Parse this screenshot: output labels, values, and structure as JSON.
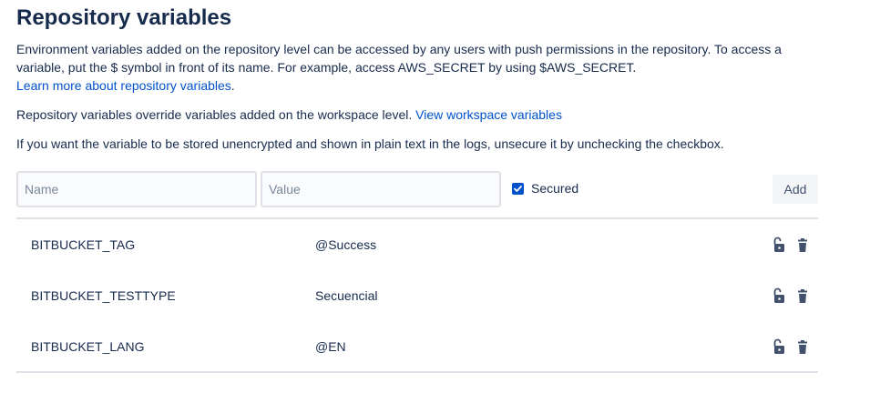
{
  "header": {
    "title": "Repository variables"
  },
  "intro": {
    "text": "Environment variables added on the repository level can be accessed by any users with push permissions in the repository. To access a variable, put the $ symbol in front of its name. For example, access AWS_SECRET by using $AWS_SECRET.",
    "learn_more_link": "Learn more about repository variables",
    "learn_more_suffix": "."
  },
  "override": {
    "text": "Repository variables override variables added on the workspace level.",
    "link": "View workspace variables"
  },
  "unsecure_note": "If you want the variable to be stored unencrypted and shown in plain text in the logs, unsecure it by unchecking the checkbox.",
  "form": {
    "name_placeholder": "Name",
    "value_placeholder": "Value",
    "secured_label": "Secured",
    "secured_checked": true,
    "add_label": "Add"
  },
  "variables": [
    {
      "name": "BITBUCKET_TAG",
      "value": "@Success",
      "lock_icon": "unlock-icon",
      "delete_icon": "trash-icon"
    },
    {
      "name": "BITBUCKET_TESTTYPE",
      "value": "Secuencial",
      "lock_icon": "unlock-icon",
      "delete_icon": "trash-icon"
    },
    {
      "name": "BITBUCKET_LANG",
      "value": "@EN",
      "lock_icon": "unlock-icon",
      "delete_icon": "trash-icon"
    }
  ],
  "colors": {
    "link": "#0052cc",
    "text": "#172b4d",
    "icon": "#42526e",
    "checkbox": "#0052cc",
    "border": "#dfe1e6"
  }
}
